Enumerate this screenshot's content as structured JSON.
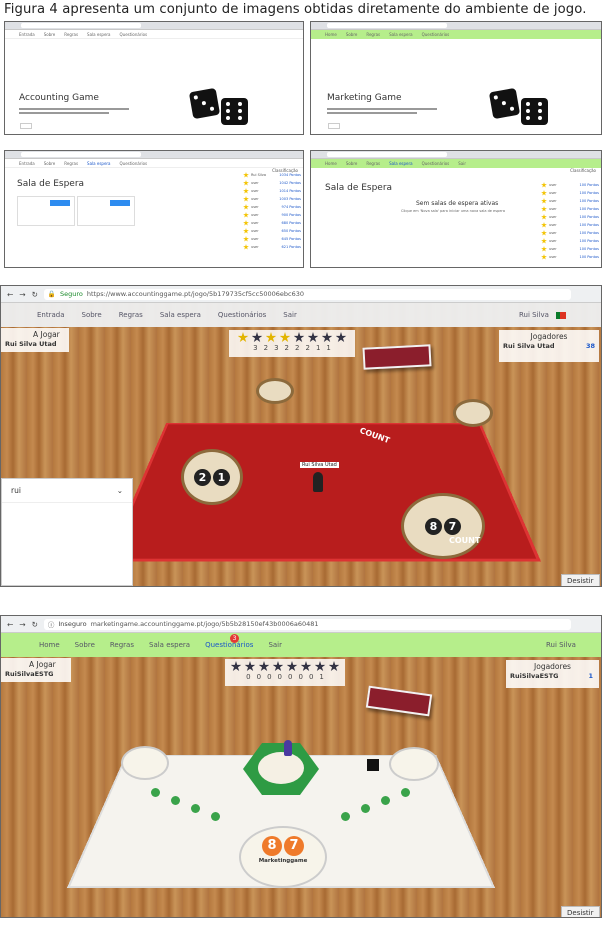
{
  "caption": "Figura 4 apresenta um conjunto de imagens obtidas diretamente do ambiente de jogo.",
  "thumbs": {
    "accounting_title": "Accounting Game",
    "marketing_title": "Marketing Game",
    "sala1_title": "Sala de Espera",
    "sala2_title": "Sala de Espera",
    "sala2_msg": "Sem salas de espera ativas",
    "sala2_sub": "Clique em 'Nova sala' para iniciar uma nova sala de espera",
    "classif": "Classificação"
  },
  "game1": {
    "secure": "Seguro",
    "url": "https://www.accountinggame.pt/jogo/5b179735cf5cc50006ebc630",
    "nav": [
      "Entrada",
      "Sobre",
      "Regras",
      "Sala espera",
      "Questionários",
      "Sair"
    ],
    "user": "Rui Silva",
    "a_jogar_title": "A Jogar",
    "a_jogar_name": "Rui Silva Utad",
    "jogadores_title": "Jogadores",
    "jogadores_name": "Rui Silva Utad",
    "jogadores_score": "38",
    "star_counts": [
      "3",
      "2",
      "3",
      "2",
      "2",
      "2",
      "1",
      "1"
    ],
    "dropdown_value": "rui",
    "token_label": "Rui Silva Utad",
    "board_label_a": "COUNT",
    "board_label_b": "COUNT",
    "desistir": "Desistir",
    "disc_left": [
      "2",
      "1"
    ],
    "disc_right": [
      "8",
      "7"
    ]
  },
  "game2": {
    "secure": "Inseguro",
    "url": "marketingame.accountinggame.pt/jogo/5b5b28150ef43b0006a60481",
    "nav": [
      "Home",
      "Sobre",
      "Regras",
      "Sala espera",
      "Questionários",
      "Sair"
    ],
    "badge": "3",
    "user": "Rui Silva",
    "a_jogar_title": "A Jogar",
    "a_jogar_name": "RuiSilvaESTG",
    "jogadores_title": "Jogadores",
    "jogadores_name": "RuiSilvaESTG",
    "jogadores_score": "1",
    "star_counts": [
      "0",
      "0",
      "0",
      "0",
      "0",
      "0",
      "0",
      "1"
    ],
    "board_label": "Marketinggame",
    "disc_bottom": [
      "8",
      "7"
    ],
    "desistir": "Desistir"
  },
  "colors": {
    "green_nav": "#b6ee8b",
    "red_board": "#b81d1d",
    "link": "#1a56c9"
  }
}
